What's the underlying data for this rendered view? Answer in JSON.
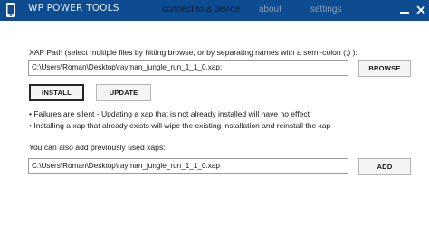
{
  "titlebar": {
    "app_title": "WP POWER TOOLS",
    "nav": {
      "connect": "connect to a device",
      "about": "about",
      "settings": "settings"
    },
    "icons": {
      "app": "phone-icon",
      "minimize": "minimize-icon",
      "close": "close-icon"
    },
    "colors": {
      "bar": "#0e4c92",
      "active_nav": "#0a1a33",
      "inactive_nav": "#8a9bb5"
    }
  },
  "main": {
    "xap_label": "XAP Path (select multiple files by hitting browse, or by separating names with a semi-colon (;) ):",
    "xap_path_value": "C:\\Users\\Roman\\Desktop\\rayman_jungle_run_1_1_0.xap;",
    "browse_label": "BROWSE",
    "install_label": "INSTALL",
    "update_label": "UPDATE",
    "notes": [
      "• Failures are silent - Updating a xap that is not already installed will have no effect",
      "• Installing a xap that already exists will wipe the existing installation and reinstall the xap"
    ],
    "previous_label": "You can also add previously used xaps:",
    "previous_value": "C:\\Users\\Roman\\Desktop\\rayman_jungle_run_1_1_0.xap",
    "add_label": "ADD"
  }
}
